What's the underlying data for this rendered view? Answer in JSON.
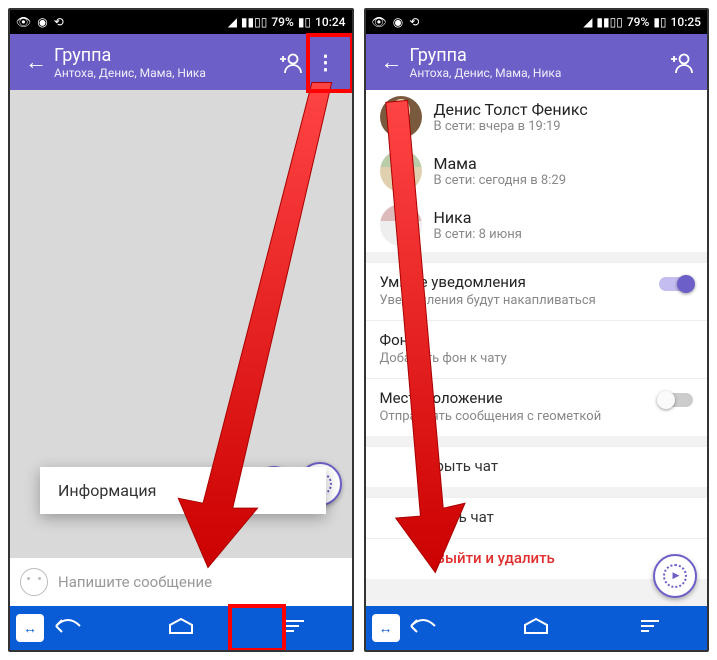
{
  "statusbar": {
    "battery": "79%",
    "time_left": "10:24",
    "time_right": "10:25"
  },
  "appbar": {
    "title": "Группа",
    "subtitle": "Антоха, Денис, Мама, Ника"
  },
  "input": {
    "placeholder": "Напишите сообщение"
  },
  "popup": {
    "info": "Информация"
  },
  "members": [
    {
      "name": "Денис Толст Феникс",
      "status": "В сети: вчера в 19:19"
    },
    {
      "name": "Мама",
      "status": "В сети: сегодня в 8:29"
    },
    {
      "name": "Ника",
      "status": "В сети: 8 июня"
    }
  ],
  "settings": {
    "smart_title": "Умные уведомления",
    "smart_desc": "Уведомления будут накапливаться",
    "bg_title": "Фон",
    "bg_desc": "Добавить фон к чату",
    "loc_title": "Местоположение",
    "loc_desc": "Отправлять сообщения с геометкой",
    "hide_title": "рыть чат",
    "clear_title": "тить чат",
    "leave_title": "Выйти и удалить"
  }
}
